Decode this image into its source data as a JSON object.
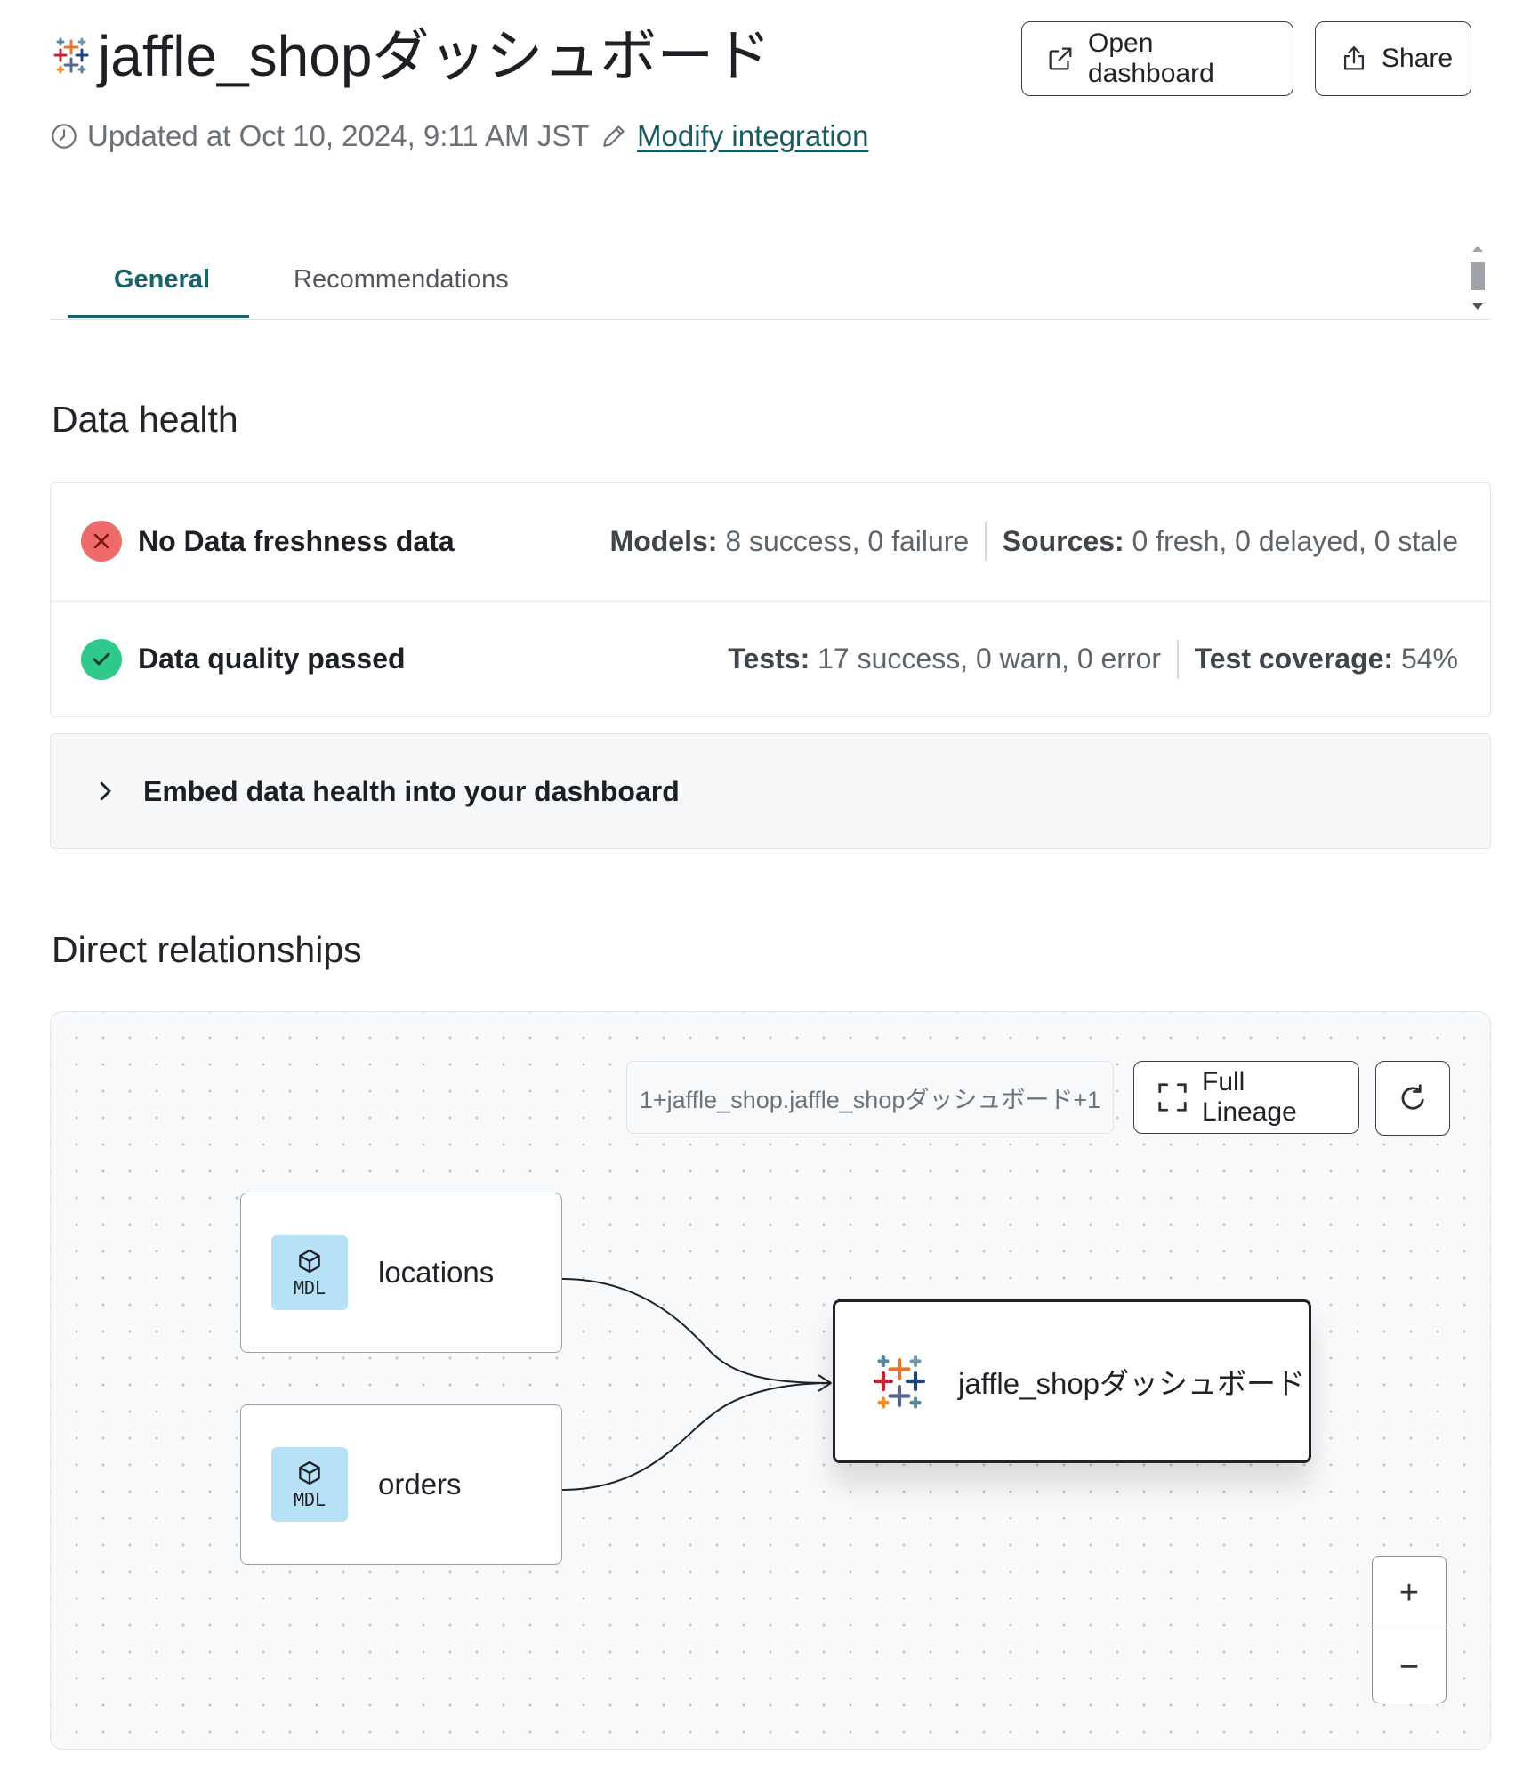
{
  "header": {
    "title": "jaffle_shopダッシュボード",
    "open_dashboard_label": "Open dashboard",
    "share_label": "Share",
    "updated_text": "Updated at Oct 10, 2024, 9:11 AM JST",
    "modify_link": "Modify integration"
  },
  "tabs": [
    {
      "label": "General",
      "active": true
    },
    {
      "label": "Recommendations",
      "active": false
    }
  ],
  "data_health": {
    "title": "Data health",
    "rows": [
      {
        "status": "error",
        "title": "No Data freshness data",
        "meta": [
          {
            "label": "Models:",
            "value": "8 success, 0 failure"
          },
          {
            "label": "Sources:",
            "value": "0 fresh, 0 delayed, 0 stale"
          }
        ]
      },
      {
        "status": "success",
        "title": "Data quality passed",
        "meta": [
          {
            "label": "Tests:",
            "value": "17 success, 0 warn, 0 error"
          },
          {
            "label": "Test coverage:",
            "value": "54%"
          }
        ]
      }
    ],
    "embed_label": "Embed data health into your dashboard"
  },
  "relationships": {
    "title": "Direct relationships",
    "breadcrumb": "1+jaffle_shop.jaffle_shopダッシュボード+1",
    "full_lineage_label": "Full Lineage",
    "nodes": [
      {
        "badge": "MDL",
        "label": "locations"
      },
      {
        "badge": "MDL",
        "label": "orders"
      }
    ],
    "target": {
      "label": "jaffle_shopダッシュボード"
    },
    "zoom_in": "+",
    "zoom_out": "−"
  },
  "colors": {
    "accent": "#17646b",
    "link": "#175b63",
    "error": "#ef6b6b",
    "success": "#2fc98b",
    "mdl_badge": "#b7e1f6"
  }
}
